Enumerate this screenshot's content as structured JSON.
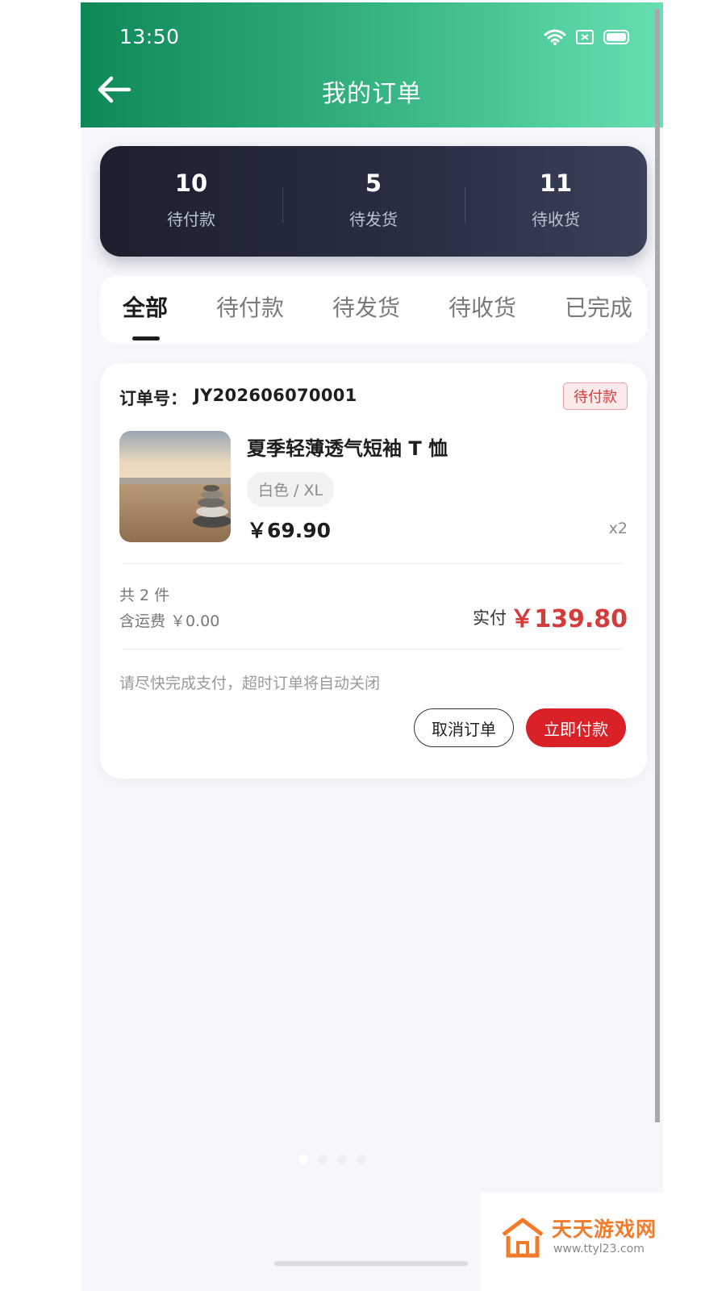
{
  "status_bar": {
    "time": "13:50"
  },
  "header": {
    "title": "我的订单"
  },
  "summary": [
    {
      "count": "10",
      "label": "待付款"
    },
    {
      "count": "5",
      "label": "待发货"
    },
    {
      "count": "11",
      "label": "待收货"
    }
  ],
  "tabs": [
    "全部",
    "待付款",
    "待发货",
    "待收货",
    "已完成"
  ],
  "active_tab": "全部",
  "order": {
    "no_label": "订单号：",
    "no": "JY202606070001",
    "status": "待付款",
    "product_name": "夏季轻薄透气短袖 T 恤",
    "variant": "白色 / XL",
    "price": "￥69.90",
    "qty": "x2",
    "total_items": "共 2 件",
    "shipping": "含运费 ￥0.00",
    "paid_label": "实付",
    "paid_amount": "￥139.80",
    "tip": "请尽快完成支付，超时订单将自动关闭",
    "cancel_label": "取消订单",
    "pay_label": "立即付款"
  },
  "watermark": {
    "name": "天天游戏网",
    "url": "www.ttyl23.com"
  },
  "colors": {
    "header_start": "#0f8857",
    "header_end": "#67e0b0",
    "accent_red": "#d43b3b",
    "pay_button": "#d92127",
    "summary_bg": "#1b1f2e"
  },
  "icons": [
    "wifi-icon",
    "sim-icon",
    "battery-icon",
    "back-arrow-icon"
  ]
}
